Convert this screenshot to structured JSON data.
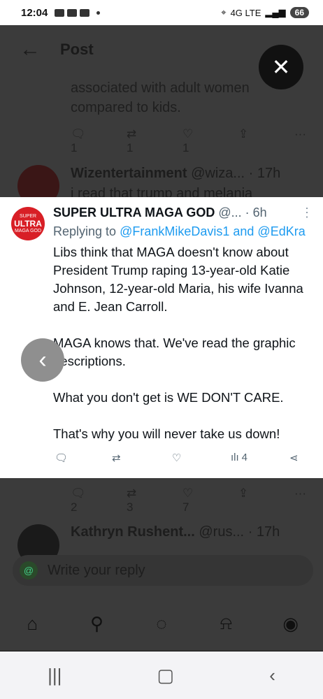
{
  "status_bar": {
    "time": "12:04",
    "network": "4G LTE",
    "battery": "66"
  },
  "header": {
    "title": "Post",
    "back_icon": "arrow-left-icon"
  },
  "background_post_top": {
    "text_line1": "associated with adult women",
    "text_line2": "compared to kids.",
    "reply_count": "1",
    "retweet_count": "1",
    "like_count": "1"
  },
  "background_post_wizent": {
    "author": "Wizentertainment",
    "handle": "@wiza...",
    "time": "· 17h",
    "snippet": "i read that trump and melania"
  },
  "featured_post": {
    "author": "SUPER ULTRA MAGA GOD",
    "handle": "@...",
    "time": "· 6h",
    "reply_prefix": "Replying to",
    "reply_to": "@FrankMikeDavis1 and @EdKra",
    "paragraphs": [
      "Libs think that MAGA doesn't know about President Trump raping 13-year-old Katie Johnson, 12-year-old Maria, his wife Ivanna and E. Jean Carroll.",
      "MAGA knows that. We've read the graphic descriptions.",
      "What you don't get is WE DON'T CARE.",
      "That's why you will never take us down!"
    ],
    "views": "4",
    "avatar_text_top": "SUPER",
    "avatar_text_mid": "ULTRA",
    "avatar_text_bottom": "MAGA GOD"
  },
  "background_post_bottom_actions": {
    "reply_count": "2",
    "retweet_count": "3",
    "like_count": "7"
  },
  "background_post_kathryn": {
    "author": "Kathryn Rushent...",
    "handle": "@rus...",
    "time": "· 17h"
  },
  "reply_box": {
    "placeholder": "Write your reply"
  },
  "colors": {
    "link": "#1d9bf0",
    "accent_red": "#d81f26"
  }
}
